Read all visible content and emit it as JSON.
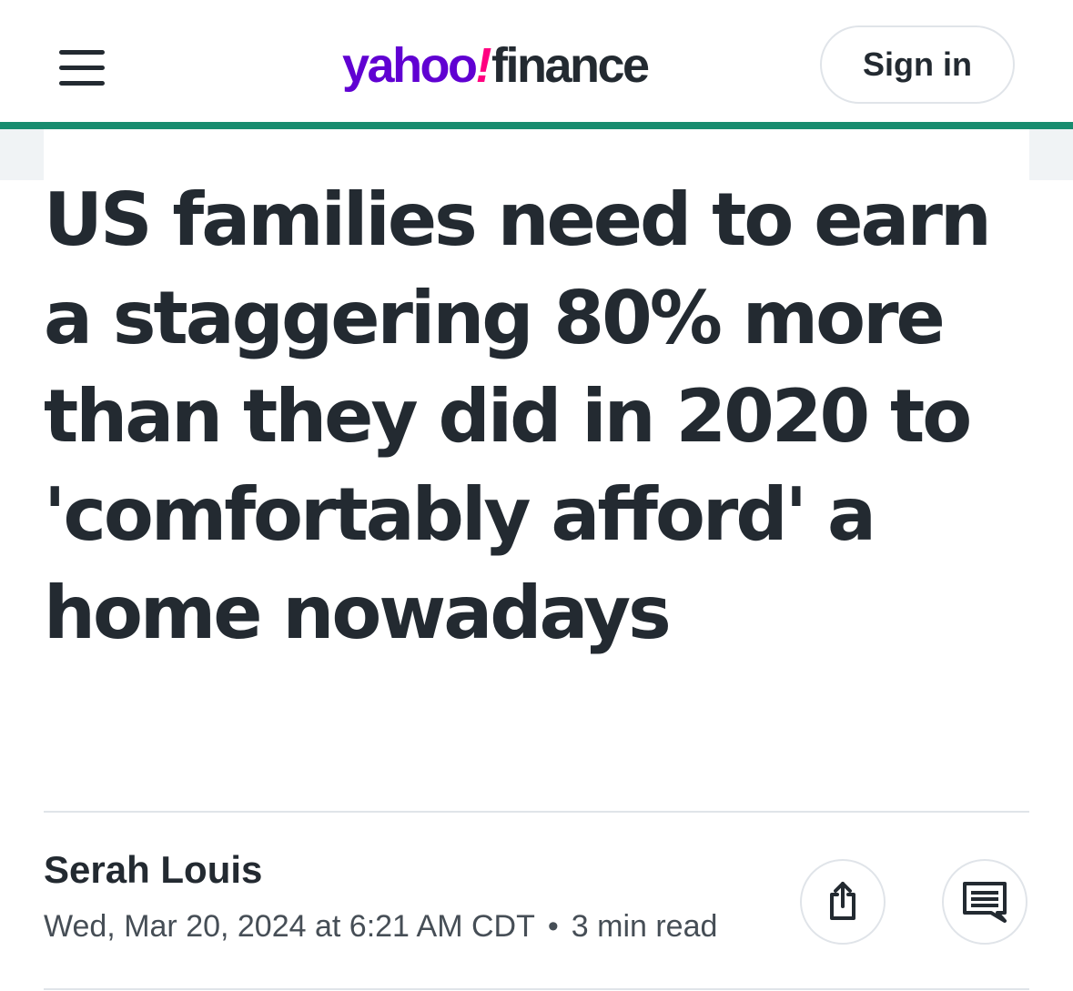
{
  "header": {
    "menu_icon": "hamburger-menu-icon",
    "logo": {
      "yahoo": "yahoo",
      "bang": "!",
      "finance": "finance"
    },
    "sign_in_label": "Sign in"
  },
  "article": {
    "headline": "US families need to earn a staggering 80% more than they did in 2020 to 'comfortably afford' a home nowadays",
    "author": "Serah Louis",
    "date": "Wed, Mar 20, 2024 at 6:21 AM CDT",
    "separator": "•",
    "read_time": "3 min read",
    "share_icon": "share-icon",
    "comment_icon": "comment-icon"
  },
  "colors": {
    "brand_purple": "#6001d2",
    "accent_pink": "#ff0080",
    "header_rule": "#188c6f",
    "text": "#232a31",
    "meta_text": "#464e56",
    "border": "#e0e4e9"
  }
}
